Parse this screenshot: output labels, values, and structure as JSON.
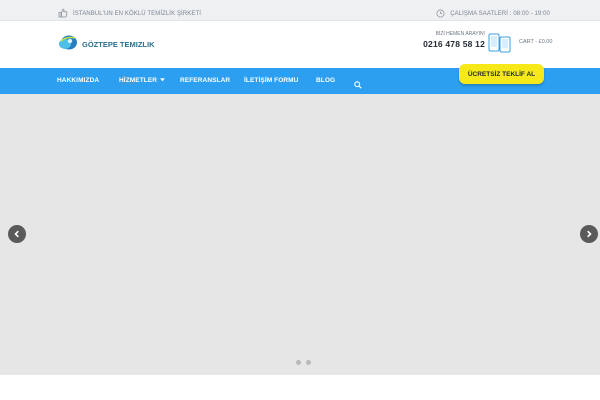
{
  "colors": {
    "topbar_bg": "#eef0f2",
    "nav_bg": "#2d9ff0",
    "cta_bg": "#f7e81a",
    "slider_bg": "#e6e6e6",
    "logo_text": "#2b6f8f"
  },
  "topbar": {
    "tagline": "İSTANBUL'UN EN KÖKLÜ TEMİZLİK ŞİRKETİ",
    "tagline_icon": "thumbs-up-icon",
    "hours": "ÇALIŞMA SAATLERİ : 08:00 - 19:00",
    "hours_icon": "clock-icon"
  },
  "header": {
    "logo_text": "GÖZTEPE TEMIZLIK",
    "logo_icon": "brand-logo-icon",
    "call_label": "BİZİ HEMEN ARAYIN!",
    "phone": "0216 478 58 12",
    "phones_icon": "mobile-phones-icon",
    "cart": "CART - £0.00"
  },
  "nav": {
    "items": [
      {
        "label": "HAKKIMIZDA"
      },
      {
        "label": "HİZMETLER",
        "has_dropdown": true
      },
      {
        "label": "REFERANSLAR"
      },
      {
        "label": "İLETİŞİM FORMU"
      },
      {
        "label": "BLOG"
      }
    ],
    "search_icon": "search-icon",
    "dropdown_icon": "caret-down-icon"
  },
  "cta": {
    "label": "ÜCRETSİZ TEKLİF AL"
  },
  "slider": {
    "prev_icon": "chevron-left-icon",
    "next_icon": "chevron-right-icon",
    "slide_count": 2,
    "active_slide": 1
  }
}
